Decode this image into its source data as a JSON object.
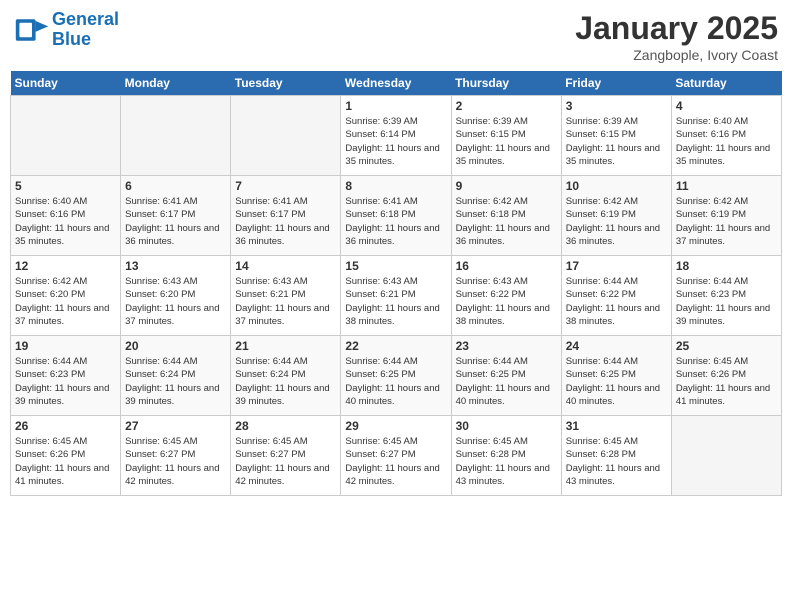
{
  "header": {
    "logo_line1": "General",
    "logo_line2": "Blue",
    "month": "January 2025",
    "location": "Zangbople, Ivory Coast"
  },
  "weekdays": [
    "Sunday",
    "Monday",
    "Tuesday",
    "Wednesday",
    "Thursday",
    "Friday",
    "Saturday"
  ],
  "weeks": [
    [
      {
        "day": "",
        "empty": true
      },
      {
        "day": "",
        "empty": true
      },
      {
        "day": "",
        "empty": true
      },
      {
        "day": "1",
        "sunrise": "6:39 AM",
        "sunset": "6:14 PM",
        "daylight": "11 hours and 35 minutes."
      },
      {
        "day": "2",
        "sunrise": "6:39 AM",
        "sunset": "6:15 PM",
        "daylight": "11 hours and 35 minutes."
      },
      {
        "day": "3",
        "sunrise": "6:39 AM",
        "sunset": "6:15 PM",
        "daylight": "11 hours and 35 minutes."
      },
      {
        "day": "4",
        "sunrise": "6:40 AM",
        "sunset": "6:16 PM",
        "daylight": "11 hours and 35 minutes."
      }
    ],
    [
      {
        "day": "5",
        "sunrise": "6:40 AM",
        "sunset": "6:16 PM",
        "daylight": "11 hours and 35 minutes."
      },
      {
        "day": "6",
        "sunrise": "6:41 AM",
        "sunset": "6:17 PM",
        "daylight": "11 hours and 36 minutes."
      },
      {
        "day": "7",
        "sunrise": "6:41 AM",
        "sunset": "6:17 PM",
        "daylight": "11 hours and 36 minutes."
      },
      {
        "day": "8",
        "sunrise": "6:41 AM",
        "sunset": "6:18 PM",
        "daylight": "11 hours and 36 minutes."
      },
      {
        "day": "9",
        "sunrise": "6:42 AM",
        "sunset": "6:18 PM",
        "daylight": "11 hours and 36 minutes."
      },
      {
        "day": "10",
        "sunrise": "6:42 AM",
        "sunset": "6:19 PM",
        "daylight": "11 hours and 36 minutes."
      },
      {
        "day": "11",
        "sunrise": "6:42 AM",
        "sunset": "6:19 PM",
        "daylight": "11 hours and 37 minutes."
      }
    ],
    [
      {
        "day": "12",
        "sunrise": "6:42 AM",
        "sunset": "6:20 PM",
        "daylight": "11 hours and 37 minutes."
      },
      {
        "day": "13",
        "sunrise": "6:43 AM",
        "sunset": "6:20 PM",
        "daylight": "11 hours and 37 minutes."
      },
      {
        "day": "14",
        "sunrise": "6:43 AM",
        "sunset": "6:21 PM",
        "daylight": "11 hours and 37 minutes."
      },
      {
        "day": "15",
        "sunrise": "6:43 AM",
        "sunset": "6:21 PM",
        "daylight": "11 hours and 38 minutes."
      },
      {
        "day": "16",
        "sunrise": "6:43 AM",
        "sunset": "6:22 PM",
        "daylight": "11 hours and 38 minutes."
      },
      {
        "day": "17",
        "sunrise": "6:44 AM",
        "sunset": "6:22 PM",
        "daylight": "11 hours and 38 minutes."
      },
      {
        "day": "18",
        "sunrise": "6:44 AM",
        "sunset": "6:23 PM",
        "daylight": "11 hours and 39 minutes."
      }
    ],
    [
      {
        "day": "19",
        "sunrise": "6:44 AM",
        "sunset": "6:23 PM",
        "daylight": "11 hours and 39 minutes."
      },
      {
        "day": "20",
        "sunrise": "6:44 AM",
        "sunset": "6:24 PM",
        "daylight": "11 hours and 39 minutes."
      },
      {
        "day": "21",
        "sunrise": "6:44 AM",
        "sunset": "6:24 PM",
        "daylight": "11 hours and 39 minutes."
      },
      {
        "day": "22",
        "sunrise": "6:44 AM",
        "sunset": "6:25 PM",
        "daylight": "11 hours and 40 minutes."
      },
      {
        "day": "23",
        "sunrise": "6:44 AM",
        "sunset": "6:25 PM",
        "daylight": "11 hours and 40 minutes."
      },
      {
        "day": "24",
        "sunrise": "6:44 AM",
        "sunset": "6:25 PM",
        "daylight": "11 hours and 40 minutes."
      },
      {
        "day": "25",
        "sunrise": "6:45 AM",
        "sunset": "6:26 PM",
        "daylight": "11 hours and 41 minutes."
      }
    ],
    [
      {
        "day": "26",
        "sunrise": "6:45 AM",
        "sunset": "6:26 PM",
        "daylight": "11 hours and 41 minutes."
      },
      {
        "day": "27",
        "sunrise": "6:45 AM",
        "sunset": "6:27 PM",
        "daylight": "11 hours and 42 minutes."
      },
      {
        "day": "28",
        "sunrise": "6:45 AM",
        "sunset": "6:27 PM",
        "daylight": "11 hours and 42 minutes."
      },
      {
        "day": "29",
        "sunrise": "6:45 AM",
        "sunset": "6:27 PM",
        "daylight": "11 hours and 42 minutes."
      },
      {
        "day": "30",
        "sunrise": "6:45 AM",
        "sunset": "6:28 PM",
        "daylight": "11 hours and 43 minutes."
      },
      {
        "day": "31",
        "sunrise": "6:45 AM",
        "sunset": "6:28 PM",
        "daylight": "11 hours and 43 minutes."
      },
      {
        "day": "",
        "empty": true
      }
    ]
  ]
}
